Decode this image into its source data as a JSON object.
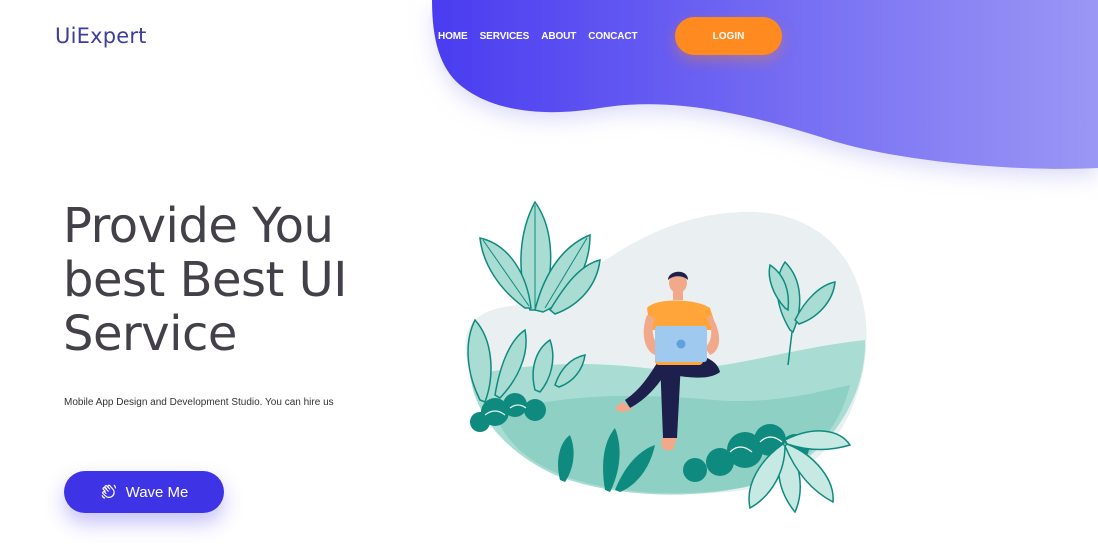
{
  "brand": {
    "logo_text": "UiExpert"
  },
  "nav": {
    "items": [
      {
        "label": "HOME"
      },
      {
        "label": "SERVICES"
      },
      {
        "label": "ABOUT"
      },
      {
        "label": "CONCACT"
      }
    ],
    "login_label": "LOGIN"
  },
  "hero": {
    "title": "Provide You best Best UI Service",
    "subtitle": "Mobile App Design and Development Studio. You can hire us",
    "cta_label": "Wave Me"
  },
  "colors": {
    "primary": "#3f33e6",
    "accent_orange": "#ff8a1f",
    "wave_start": "#4a3cf0",
    "wave_end": "#9b97f5",
    "teal": "#0f8a7e",
    "mint": "#a9ddd4"
  },
  "icons": {
    "cta_icon": "waving-hand-icon"
  }
}
